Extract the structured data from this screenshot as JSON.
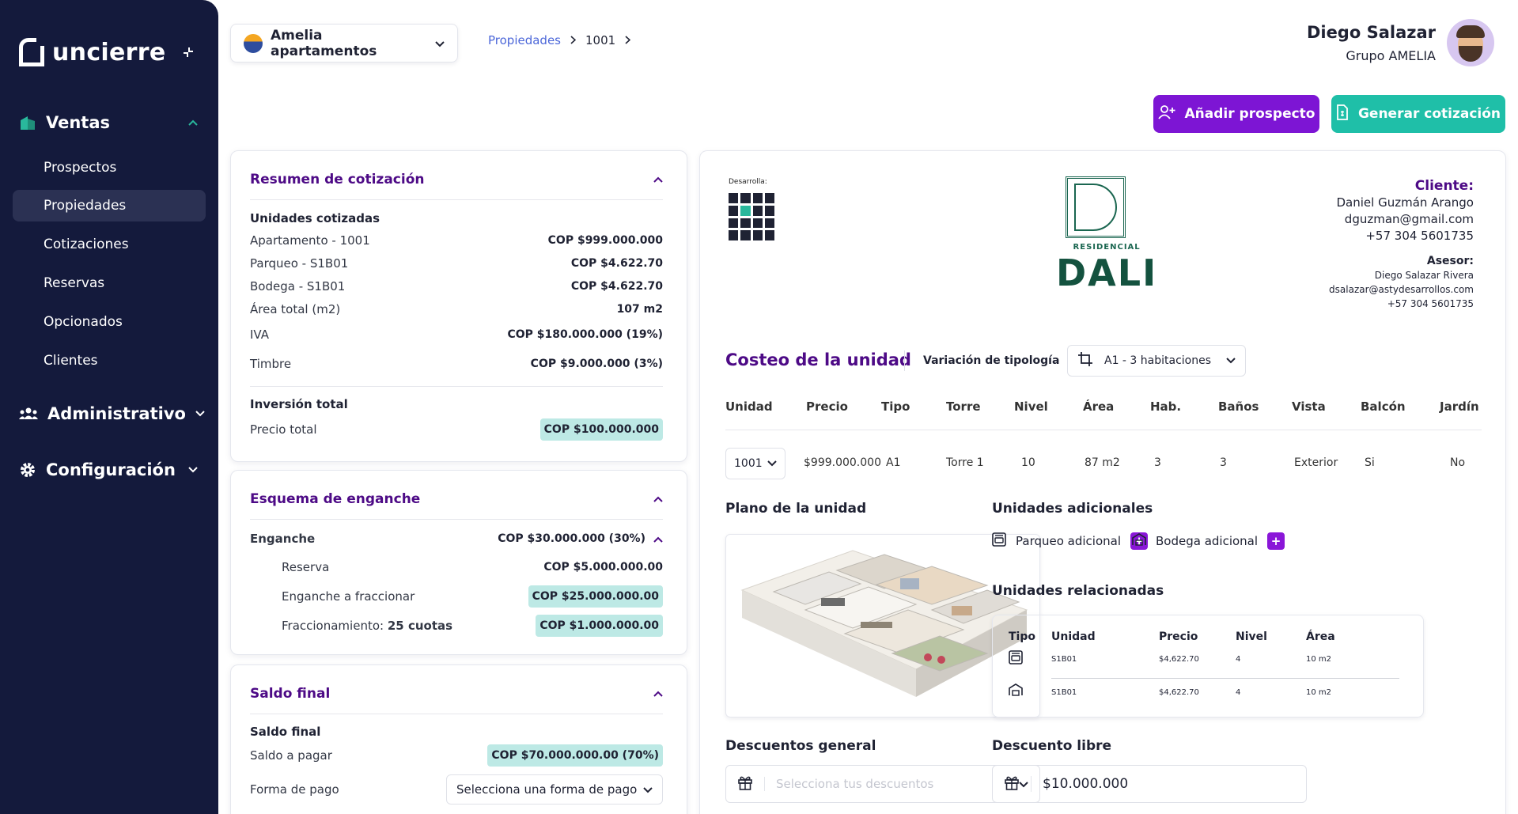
{
  "app": {
    "logo": "uncierre"
  },
  "sidebar": {
    "groups": [
      {
        "label": "Ventas",
        "icon": "ventas-icon"
      },
      {
        "label": "Administrativo",
        "icon": "users-icon"
      },
      {
        "label": "Configuración",
        "icon": "gear-icon"
      }
    ],
    "items": [
      "Prospectos",
      "Propiedades",
      "Cotizaciones",
      "Reservas",
      "Opcionados",
      "Clientes"
    ],
    "active_item": "Propiedades"
  },
  "header": {
    "project": "Amelia apartamentos",
    "breadcrumb": {
      "root": "Propiedades",
      "current": "1001"
    },
    "user": {
      "name": "Diego Salazar",
      "org": "Grupo AMELIA"
    },
    "buttons": {
      "add_prospect": "Añadir prospecto",
      "quote": "Generar cotización"
    }
  },
  "summary": {
    "title": "Resumen de cotización",
    "units_title": "Unidades cotizadas",
    "rows": [
      {
        "label": "Apartamento - 1001",
        "value": "COP $999.000.000"
      },
      {
        "label": "Parqueo - S1B01",
        "value": "COP $4.622.70"
      },
      {
        "label": "Bodega - S1B01",
        "value": "COP $4.622.70"
      },
      {
        "label": "Área total (m2)",
        "value": "107 m2"
      },
      {
        "label": "IVA",
        "value": "COP $180.000.000 (19%)"
      },
      {
        "label": "Timbre",
        "value": "COP $9.000.000 (3%)"
      }
    ],
    "investment_title": "Inversión total",
    "total_label": "Precio total",
    "total_value": "COP $100.000.000"
  },
  "enganche": {
    "title": "Esquema de enganche",
    "label": "Enganche",
    "value": "COP $30.000.000 (30%)",
    "reserva_label": "Reserva",
    "reserva_value": "COP $5.000.000.00",
    "fraccionar_label": "Enganche a fraccionar",
    "fraccionar_value": "COP $25.000.000.00",
    "fracc_label": "Fraccionamiento:",
    "fracc_cuotas": "25 cuotas",
    "fracc_value": "COP $1.000.000.00"
  },
  "saldo": {
    "title": "Saldo final",
    "sub_title": "Saldo final",
    "pagar_label": "Saldo a pagar",
    "pagar_value": "COP $70.000.000.00 (70%)",
    "forma_label": "Forma de pago",
    "forma_placeholder": "Selecciona una forma de pago"
  },
  "quote": {
    "developer_label": "Desarrolla:",
    "project_sub": "RESIDENCIAL",
    "project_name": "DALI",
    "client_title": "Cliente:",
    "client_name": "Daniel Guzmán Arango",
    "client_email": "dguzman@gmail.com",
    "client_phone": "+57 304 5601735",
    "advisor_title": "Asesor:",
    "advisor_name": "Diego Salazar Rivera",
    "advisor_email": "dsalazar@astydesarrollos.com",
    "advisor_phone": "+57 304 5601735",
    "costeo_title": "Costeo de la unidad",
    "variation_label": "Variación de tipología",
    "variation_value": "A1 - 3 habitaciones",
    "columns": [
      "Unidad",
      "Precio",
      "Tipo",
      "Torre",
      "Nivel",
      "Área",
      "Hab.",
      "Baños",
      "Vista",
      "Balcón",
      "Jardín"
    ],
    "unit_row": [
      "1001",
      "$999.000.000",
      "A1",
      "Torre 1",
      "10",
      "87 m2",
      "3",
      "3",
      "Exterior",
      "Si",
      "No"
    ],
    "plan_title": "Plano de la unidad",
    "additional_title": "Unidades adicionales",
    "additional": [
      "Parqueo adicional",
      "Bodega adicional"
    ],
    "related_title": "Unidades relacionadas",
    "related_columns": [
      "Tipo",
      "Unidad",
      "Precio",
      "Nivel",
      "Área"
    ],
    "related_rows": [
      {
        "type_icon": "parking-icon",
        "unit": "S1B01",
        "price": "$4,622.70",
        "level": "4",
        "area": "10 m2"
      },
      {
        "type_icon": "storage-icon",
        "unit": "S1B01",
        "price": "$4,622.70",
        "level": "4",
        "area": "10 m2"
      }
    ],
    "discount_general_title": "Descuentos general",
    "discount_general_placeholder": "Selecciona tus descuentos",
    "discount_free_title": "Descuento libre",
    "discount_free_value": "$10.000.000"
  }
}
